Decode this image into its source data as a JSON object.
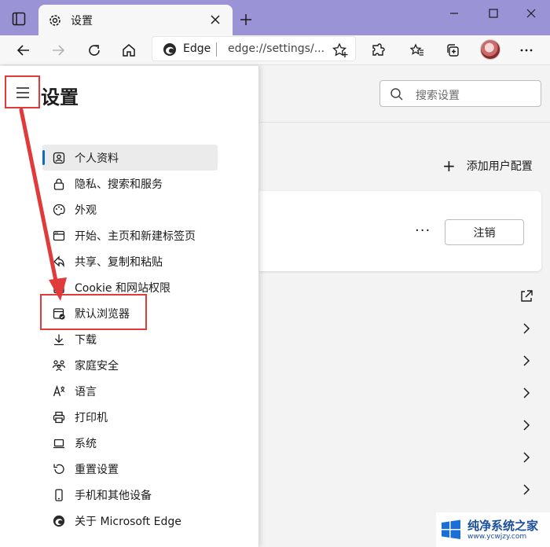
{
  "tab": {
    "title": "设置"
  },
  "address": {
    "site_label": "Edge",
    "url": "edge://settings/..."
  },
  "sidebar": {
    "title": "设置",
    "items": [
      {
        "label": "个人资料",
        "icon": "profile-icon",
        "selected": true
      },
      {
        "label": "隐私、搜索和服务",
        "icon": "lock-icon"
      },
      {
        "label": "外观",
        "icon": "palette-icon"
      },
      {
        "label": "开始、主页和新建标签页",
        "icon": "home-window-icon"
      },
      {
        "label": "共享、复制和粘贴",
        "icon": "share-icon"
      },
      {
        "label": "Cookie 和网站权限",
        "icon": "site-permissions-icon"
      },
      {
        "label": "默认浏览器",
        "icon": "default-browser-icon"
      },
      {
        "label": "下载",
        "icon": "download-icon"
      },
      {
        "label": "家庭安全",
        "icon": "family-icon"
      },
      {
        "label": "语言",
        "icon": "language-icon"
      },
      {
        "label": "打印机",
        "icon": "printer-icon"
      },
      {
        "label": "系统",
        "icon": "laptop-icon"
      },
      {
        "label": "重置设置",
        "icon": "reset-icon"
      },
      {
        "label": "手机和其他设备",
        "icon": "phone-icon"
      },
      {
        "label": "关于 Microsoft Edge",
        "icon": "edge-logo-icon"
      }
    ]
  },
  "search": {
    "placeholder": "搜索设置"
  },
  "main": {
    "add_profile": "添加用户配置",
    "more": "···",
    "sign_out": "注销"
  },
  "colors": {
    "titlebar": "#9a94d6",
    "annotation": "#e03a3a",
    "selected_accent": "#0f6cbd"
  },
  "watermark": {
    "name": "纯净系统之家",
    "url": "www.ycwjzy.com"
  }
}
